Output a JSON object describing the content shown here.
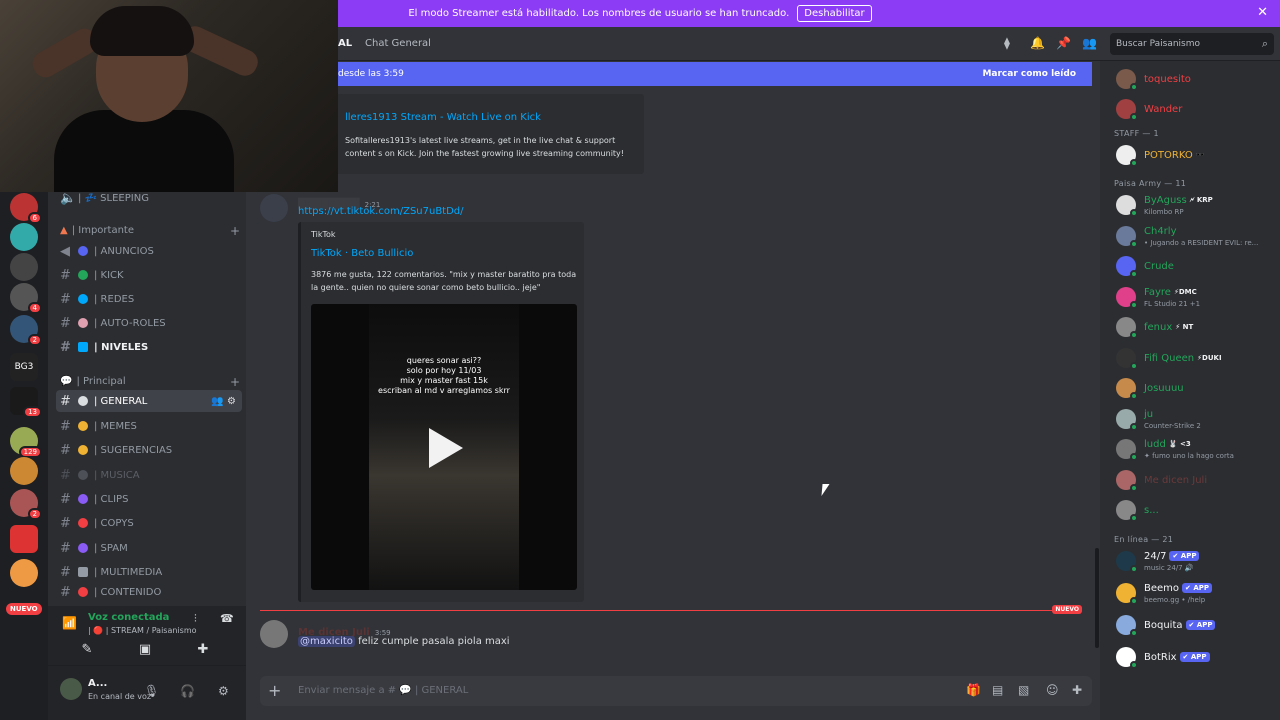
{
  "banner": {
    "text": "El modo Streamer está habilitado. Los nombres de usuario se han truncado.",
    "button": "Deshabilitar",
    "close": "✕"
  },
  "servers": {
    "badges": [
      "6",
      "4",
      "2",
      "13",
      "129",
      "2"
    ],
    "new_label": "NUEVO",
    "bg3_label": "BG3"
  },
  "channels": {
    "sleeping": "| 💤 SLEEPING",
    "cat_importante": "| Importante",
    "cat_principal": "| Principal",
    "items_importante": [
      {
        "label": "| ANUNCIOS",
        "color": "#5865f2"
      },
      {
        "label": "| KICK",
        "color": "#23a55a"
      },
      {
        "label": "| REDES",
        "color": "#00a8fc"
      },
      {
        "label": "| AUTO-ROLES",
        "color": "#e0a0b0"
      },
      {
        "label": "| NIVELES",
        "color": "#00a8fc"
      }
    ],
    "items_principal": [
      {
        "label": "| GENERAL",
        "color": "#dbdee1"
      },
      {
        "label": "| MEMES",
        "color": "#f0b232"
      },
      {
        "label": "| SUGERENCIAS",
        "color": "#f0b232"
      },
      {
        "label": "| MUSICA",
        "color": "#5c5f66"
      },
      {
        "label": "| CLIPS",
        "color": "#8a5cf5"
      },
      {
        "label": "| COPYS",
        "color": "#f23f43"
      },
      {
        "label": "| SPAM",
        "color": "#8a5cf5"
      },
      {
        "label": "| MULTIMEDIA",
        "color": "#949ba4"
      },
      {
        "label": "| CONTENIDO",
        "color": "#f23f43"
      }
    ]
  },
  "voice": {
    "title": "Voz conectada",
    "sub": "| 🔴 | STREAM / Paisanismo"
  },
  "user": {
    "name": "A...",
    "status": "En canal de voz"
  },
  "topbar": {
    "channel_prefix": "AL",
    "title": "Chat General",
    "search_placeholder": "Buscar Paisanismo"
  },
  "newbar": {
    "left": "desde las 3:59",
    "right": "Marcar como leído"
  },
  "embed_kick": {
    "title": "lleres1913 Stream - Watch Live on Kick",
    "desc": "Sofitalleres1913's latest live streams, get in the live chat & support content s on Kick. Join the fastest growing live streaming community!"
  },
  "msg_tiktok": {
    "time": "2:21",
    "link": "https://vt.tiktok.com/ZSu7uBtDd/",
    "provider": "TikTok",
    "title": "TikTok · Beto Bullicio",
    "desc": "3876 me gusta, 122 comentarios. \"mix y master baratito pra toda la gente.. quien no quiere sonar como beto bullicio.. jeje\"",
    "video_text": "queres sonar asi??\nsolo por hoy 11/03\nmix y master fast 15k\nescriban al md v arreglamos skrr"
  },
  "divider_label": "NUEVO",
  "msg_last": {
    "author": "Me dicen Juli",
    "time": "3:59",
    "mention": "@maxicito",
    "text": "feliz cumple pasala piola maxi"
  },
  "composer": {
    "placeholder": "Enviar mensaje a # 💬 | GENERAL"
  },
  "members": {
    "top": [
      {
        "name": "toquesito",
        "color": "#f23f43"
      },
      {
        "name": "Wander",
        "color": "#f23f43"
      }
    ],
    "staff_header": "STAFF — 1",
    "staff": [
      {
        "name": "POTORKO",
        "tag": "🕶️",
        "color": "#f0b232"
      }
    ],
    "paisa_header": "Paisa Army — 11",
    "paisa": [
      {
        "name": "ByAguss",
        "tag": "🗲 KRP",
        "sub": "Kilombo RP",
        "color": "#23a55a"
      },
      {
        "name": "Ch4rly",
        "tag": "",
        "sub": "• Jugando a RESIDENT EVIL: re...",
        "color": "#23a55a"
      },
      {
        "name": "Crude",
        "tag": "",
        "sub": "",
        "color": "#23a55a"
      },
      {
        "name": "Fayre",
        "tag": "⚡DMC",
        "sub": "FL Studio 21 +1",
        "color": "#23a55a"
      },
      {
        "name": "fenux",
        "tag": "⚡ NT",
        "sub": "",
        "color": "#23a55a"
      },
      {
        "name": "Fifi Queen",
        "tag": "⚡DUKI",
        "sub": "",
        "color": "#23a55a"
      },
      {
        "name": "Josuuuu",
        "tag": "",
        "sub": "",
        "color": "#23a55a"
      },
      {
        "name": "ju",
        "tag": "",
        "sub": "Counter-Strike 2",
        "color": "#23a55a"
      },
      {
        "name": "ludd",
        "tag": "🐰 <3",
        "sub": "✦ fumo uno la hago corta",
        "color": "#23a55a"
      },
      {
        "name": "Me dicen Juli",
        "tag": "",
        "sub": "",
        "color": "#6b3a3a"
      },
      {
        "name": "s...",
        "tag": "",
        "sub": "",
        "color": "#23a55a"
      }
    ],
    "online_header": "En línea — 21",
    "online": [
      {
        "name": "24/7",
        "tag": "✔ APP",
        "sub": "music 24/7 🔊"
      },
      {
        "name": "Beemo",
        "tag": "✔ APP",
        "sub": "beemo.gg • /help"
      },
      {
        "name": "Boquita",
        "tag": "✔ APP",
        "sub": ""
      },
      {
        "name": "BotRix",
        "tag": "✔ APP",
        "sub": ""
      }
    ]
  }
}
